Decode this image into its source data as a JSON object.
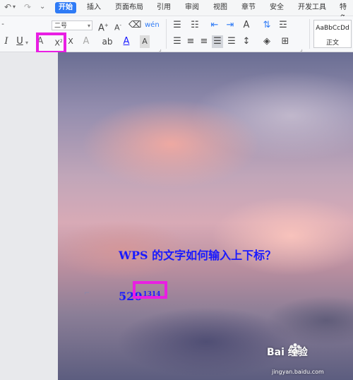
{
  "quick_access": {
    "undo": "↶",
    "redo": "↷",
    "more": "⌄"
  },
  "menu": {
    "tabs": [
      {
        "label": "开始",
        "active": true
      },
      {
        "label": "插入"
      },
      {
        "label": "页面布局"
      },
      {
        "label": "引用"
      },
      {
        "label": "审阅"
      },
      {
        "label": "视图"
      },
      {
        "label": "章节"
      },
      {
        "label": "安全"
      },
      {
        "label": "开发工具"
      },
      {
        "label": "特色"
      }
    ]
  },
  "ribbon": {
    "font_size_value": "二号",
    "style_preview": "AaBbCcDd",
    "style_name": "正文",
    "icons": [
      "increase-font-icon",
      "decrease-font-icon",
      "clear-format-icon",
      "pinyin-icon",
      "italic-icon",
      "underline-icon",
      "strikethrough-icon",
      "superscript-icon",
      "subscript-icon",
      "text-effect-icon",
      "highlight-icon",
      "font-color-icon",
      "char-border-icon",
      "bullets-icon",
      "numbering-icon",
      "decrease-indent-icon",
      "increase-indent-icon",
      "chinese-layout-icon",
      "sort-icon",
      "show-marks-icon",
      "align-left-icon",
      "align-center-icon",
      "align-right-icon",
      "justify-icon",
      "distributed-icon",
      "line-spacing-icon",
      "shading-icon",
      "borders-icon"
    ],
    "highlight_color": "#e91ee3"
  },
  "document": {
    "title_line": "WPS 的文字如何输入上下标？",
    "base_number": "520",
    "superscript": "1314",
    "text_color": "#1a1aff"
  },
  "watermark": {
    "brand": "Bai 经验",
    "url": "jingyan.baidu.com"
  }
}
